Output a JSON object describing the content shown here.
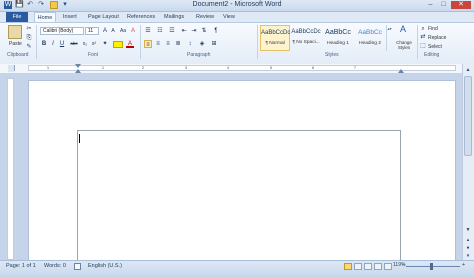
{
  "window": {
    "title": "Document2 - Microsoft Word",
    "quick_access": {
      "word_icon": "W",
      "save": "💾",
      "undo": "↶",
      "redo": "↷",
      "customize": "▾"
    },
    "controls": {
      "minimize": "–",
      "maximize": "□",
      "close": "✕"
    }
  },
  "tabs": [
    "File",
    "Home",
    "Insert",
    "Page Layout",
    "References",
    "Mailings",
    "Review",
    "View"
  ],
  "ribbon": {
    "clipboard": {
      "label": "Clipboard",
      "paste": "Paste"
    },
    "font": {
      "label": "Font",
      "name": "Calibri (Body)",
      "size": "11",
      "bold": "B",
      "italic": "I",
      "underline": "U",
      "strike": "abc",
      "sub": "x₂",
      "sup": "x²",
      "grow": "A",
      "shrink": "A",
      "case": "Aa",
      "clear": "A",
      "font_color": "A"
    },
    "paragraph": {
      "label": "Paragraph",
      "pilcrow": "¶"
    },
    "styles": {
      "label": "Styles",
      "items": [
        {
          "preview": "AaBbCcDc",
          "name": "¶ Normal"
        },
        {
          "preview": "AaBbCcDc",
          "name": "¶ No Spaci..."
        },
        {
          "preview": "AaBbCc",
          "name": "Heading 1"
        },
        {
          "preview": "AaBbCc",
          "name": "Heading 2"
        }
      ],
      "change_styles": "Change Styles"
    },
    "editing": {
      "label": "Editing",
      "find": "Find",
      "replace": "Replace",
      "select": "Select"
    }
  },
  "ruler": {
    "numbers": [
      "1",
      "1",
      "2",
      "3",
      "4",
      "5",
      "6",
      "7"
    ]
  },
  "status": {
    "page": "Page: 1 of 1",
    "words": "Words: 0",
    "language": "English (U.S.)",
    "zoom": "119%"
  },
  "colors": {
    "accent": "#2a5aa0",
    "ribbon_bg": "#e3ecf7",
    "workspace": "#c5d4e8"
  }
}
